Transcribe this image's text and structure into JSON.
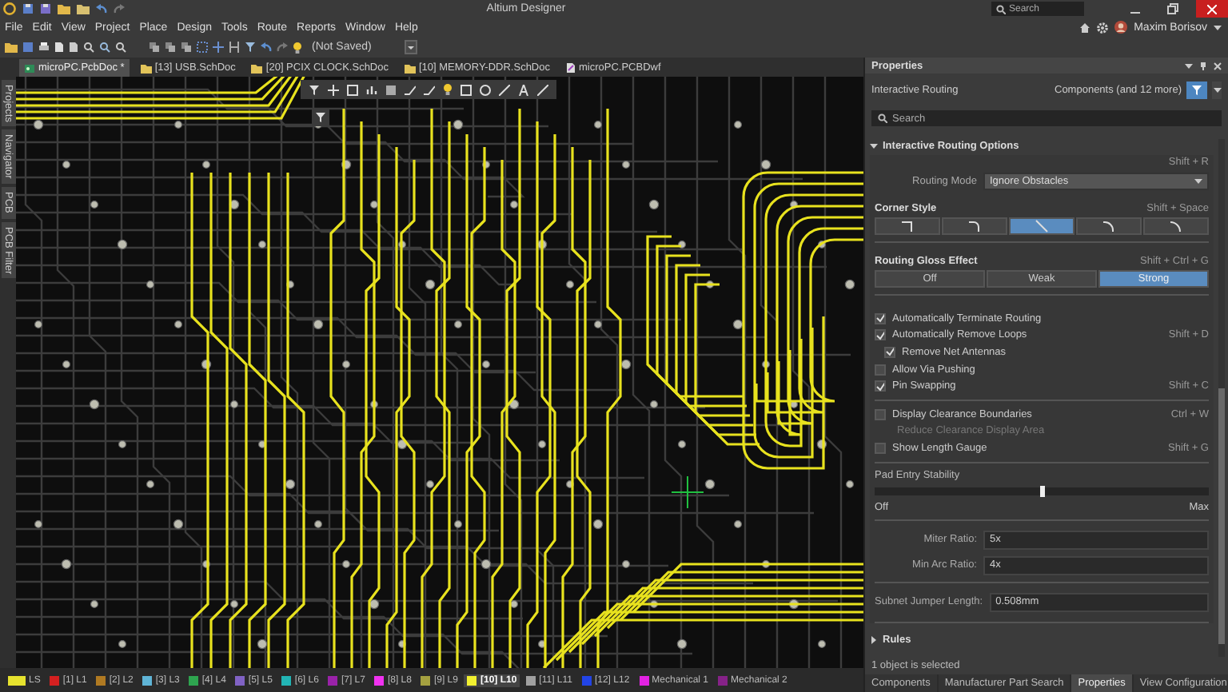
{
  "window": {
    "title": "Altium Designer",
    "search_placeholder": "Search"
  },
  "menu": [
    "File",
    "Edit",
    "View",
    "Project",
    "Place",
    "Design",
    "Tools",
    "Route",
    "Reports",
    "Window",
    "Help"
  ],
  "user": {
    "name": "Maxim Borisov"
  },
  "toolbar": {
    "status": "(Not Saved)"
  },
  "document_tabs": [
    {
      "label": "microPC.PcbDoc *",
      "selected": true,
      "kind": "pcb"
    },
    {
      "label": "[13] USB.SchDoc",
      "selected": false,
      "kind": "sch"
    },
    {
      "label": "[20] PCIX CLOCK.SchDoc",
      "selected": false,
      "kind": "sch"
    },
    {
      "label": "[10] MEMORY-DDR.SchDoc",
      "selected": false,
      "kind": "sch"
    },
    {
      "label": "microPC.PCBDwf",
      "selected": false,
      "kind": "dwf"
    }
  ],
  "side_panels": [
    "Projects",
    "Navigator",
    "PCB",
    "PCB Filter"
  ],
  "properties": {
    "title": "Properties",
    "context": "Interactive Routing",
    "filter": "Components (and 12 more)",
    "search_placeholder": "Search",
    "routing_options": {
      "title": "Interactive Routing Options",
      "expanded": true,
      "mode_shortcut": "Shift + R",
      "routing_mode_label": "Routing Mode",
      "routing_mode": "Ignore Obstacles",
      "corner_style": {
        "label": "Corner Style",
        "shortcut": "Shift + Space",
        "options": [
          {
            "kind": "right-angle",
            "selected": false
          },
          {
            "kind": "rounded",
            "selected": false
          },
          {
            "kind": "diagonal",
            "selected": true
          },
          {
            "kind": "diagonal-arc",
            "selected": false
          },
          {
            "kind": "arc",
            "selected": false
          }
        ]
      },
      "gloss": {
        "label": "Routing Gloss Effect",
        "shortcut": "Shift + Ctrl + G",
        "options": [
          {
            "label": "Off",
            "selected": false
          },
          {
            "label": "Weak",
            "selected": false
          },
          {
            "label": "Strong",
            "selected": true
          }
        ]
      },
      "option_groups": [
        [
          {
            "kind": "checkbox",
            "label": "Automatically Terminate Routing",
            "checked": true
          },
          {
            "kind": "checkbox",
            "label": "Automatically Remove Loops",
            "checked": true,
            "shortcut": "Shift + D",
            "children": [
              {
                "kind": "checkbox",
                "label": "Remove Net Antennas",
                "checked": true
              }
            ]
          },
          {
            "kind": "checkbox",
            "label": "Allow Via Pushing",
            "checked": false
          },
          {
            "kind": "checkbox",
            "label": "Pin Swapping",
            "checked": true,
            "shortcut": "Shift + C"
          }
        ],
        [
          {
            "kind": "checkbox",
            "label": "Display Clearance Boundaries",
            "checked": false,
            "shortcut": "Ctrl + W",
            "children": [
              {
                "kind": "text",
                "label": "Reduce Clearance Display Area",
                "disabled": true
              }
            ]
          },
          {
            "kind": "checkbox",
            "label": "Show Length Gauge",
            "checked": false,
            "shortcut": "Shift + G"
          }
        ]
      ],
      "pad_entry": {
        "label": "Pad Entry Stability",
        "level": 0.5,
        "min_label": "Off",
        "max_label": "Max"
      },
      "ratio_fields": [
        {
          "label": "Miter Ratio:",
          "value": "5x"
        },
        {
          "label": "Min Arc Ratio:",
          "value": "4x"
        }
      ],
      "subnet_field": {
        "label": "Subnet Jumper Length:",
        "value": "0.508mm"
      }
    },
    "rules": {
      "title": "Rules",
      "expanded": false
    },
    "status": "1 object is selected",
    "tabs": [
      {
        "label": "Components",
        "selected": false
      },
      {
        "label": "Manufacturer Part Search",
        "selected": false
      },
      {
        "label": "Properties",
        "selected": true
      },
      {
        "label": "View Configuration",
        "selected": false
      }
    ]
  },
  "layers": [
    {
      "label": "LS",
      "color": "#e6e22e",
      "selected": false
    },
    {
      "label": "[1] L1",
      "color": "#d42020",
      "selected": false
    },
    {
      "label": "[2] L2",
      "color": "#b07a22",
      "selected": false
    },
    {
      "label": "[3] L3",
      "color": "#5fb4d6",
      "selected": false
    },
    {
      "label": "[4] L4",
      "color": "#2ea44f",
      "selected": false
    },
    {
      "label": "[5] L5",
      "color": "#8062c4",
      "selected": false
    },
    {
      "label": "[6] L6",
      "color": "#22b4b4",
      "selected": false
    },
    {
      "label": "[7] L7",
      "color": "#9a22a8",
      "selected": false
    },
    {
      "label": "[8] L8",
      "color": "#f032f0",
      "selected": false
    },
    {
      "label": "[9] L9",
      "color": "#a4a040",
      "selected": false
    },
    {
      "label": "[10] L10",
      "color": "#f2f030",
      "selected": true
    },
    {
      "label": "[11] L11",
      "color": "#a0a0a0",
      "selected": false
    },
    {
      "label": "[12] L12",
      "color": "#2244e6",
      "selected": false
    },
    {
      "label": "Mechanical 1",
      "color": "#e222e2",
      "selected": false
    },
    {
      "label": "Mechanical 2",
      "color": "#862288",
      "selected": false
    }
  ]
}
